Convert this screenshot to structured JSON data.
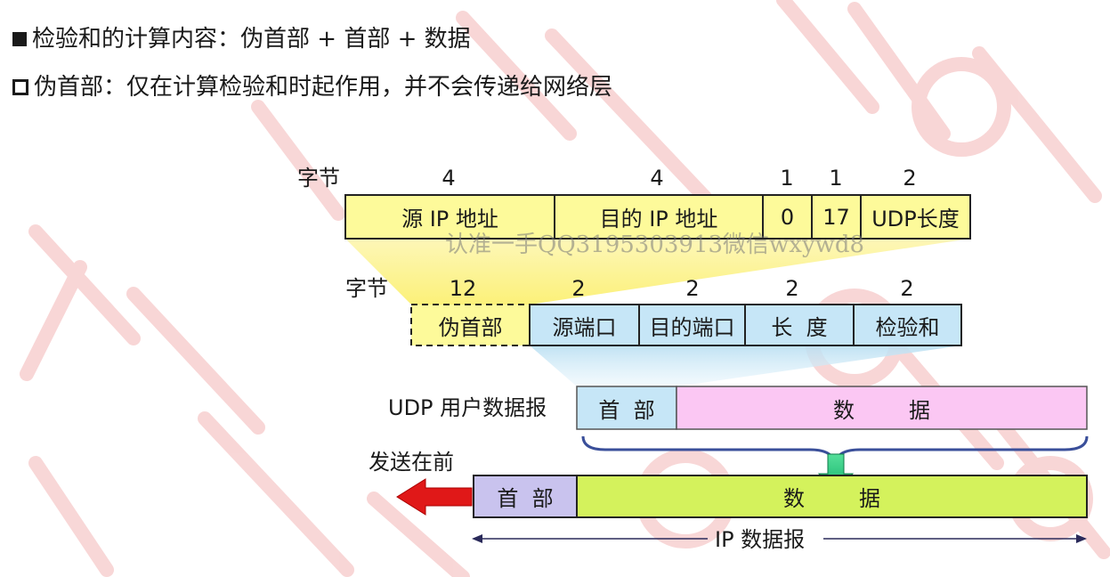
{
  "bullets": [
    {
      "text": "检验和的计算内容：伪首部 + 首部 + 数据",
      "marker": "filled-square"
    },
    {
      "text": "伪首部：仅在计算检验和时起作用，并不会传递给网络层",
      "marker": "hollow-square"
    }
  ],
  "pseudo_header": {
    "bytes_label": "字节",
    "sizes": [
      "4",
      "4",
      "1",
      "1",
      "2"
    ],
    "fields": [
      "源 IP 地址",
      "目的 IP 地址",
      "0",
      "17",
      "UDP长度"
    ]
  },
  "udp_header": {
    "bytes_label": "字节",
    "sizes": [
      "12",
      "2",
      "2",
      "2",
      "2"
    ],
    "fields": [
      "伪首部",
      "源端口",
      "目的端口",
      "长  度",
      "检验和"
    ]
  },
  "udp_datagram": {
    "label": "UDP 用户数据报",
    "header": "首  部",
    "data": "数        据"
  },
  "ip_datagram": {
    "send_first": "发送在前",
    "header": "首  部",
    "data": "数        据",
    "label": "IP 数据报"
  },
  "watermark": "认准一手QQ3195303913微信wxywd8",
  "colors": {
    "pseudo_fill": "#fdfa9a",
    "udp_header_fill": "#c6e6f7",
    "udp_data_fill": "#fbc7f3",
    "ip_header_fill": "#c9c3ee",
    "ip_data_fill": "#d4f25c",
    "red_arrow": "#e01818",
    "green_arrow": "#27c27a",
    "background_watermark": "#f7c8c8"
  }
}
